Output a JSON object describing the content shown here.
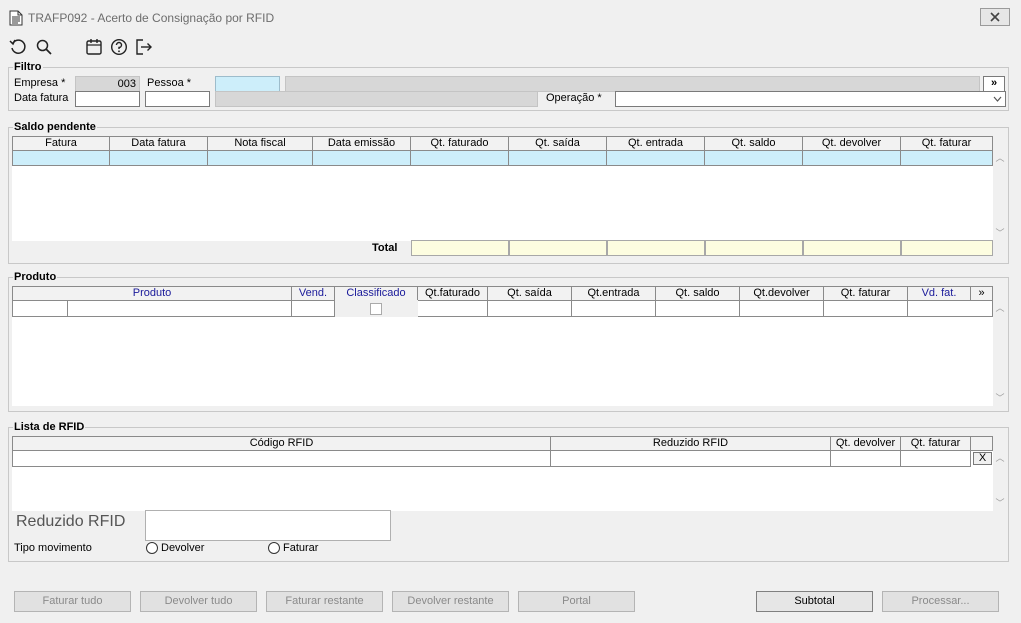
{
  "window": {
    "title": "TRAFP092 - Acerto de Consignação por RFID",
    "close_label": "X"
  },
  "toolbar": {
    "icons": [
      "refresh-icon",
      "search-icon",
      "calendar-icon",
      "help-icon",
      "exit-icon"
    ]
  },
  "filtro": {
    "title": "Filtro",
    "empresa_label": "Empresa *",
    "empresa_value": "003",
    "pessoa_label": "Pessoa *",
    "pessoa_value": "",
    "more_label": "»",
    "data_fatura_label": "Data fatura",
    "operacao_label": "Operação *",
    "operacao_value": ""
  },
  "saldo": {
    "title": "Saldo pendente",
    "columns": [
      "Fatura",
      "Data fatura",
      "Nota fiscal",
      "Data emissão",
      "Qt. faturado",
      "Qt. saída",
      "Qt. entrada",
      "Qt. saldo",
      "Qt. devolver",
      "Qt. faturar"
    ],
    "total_label": "Total"
  },
  "produto": {
    "title": "Produto",
    "columns": [
      "Produto",
      "Vend.",
      "Classificado",
      "Qt.faturado",
      "Qt. saída",
      "Qt.entrada",
      "Qt. saldo",
      "Qt.devolver",
      "Qt. faturar",
      "Vd. fat.",
      "»"
    ]
  },
  "rfid": {
    "title": "Lista de RFID",
    "columns": [
      "Código RFID",
      "Reduzido RFID",
      "Qt. devolver",
      "Qt. faturar",
      ""
    ],
    "remove_label": "X",
    "reduzido_label": "Reduzido RFID",
    "reduzido_value": "",
    "tipo_label": "Tipo movimento",
    "devolver_label": "Devolver",
    "faturar_label": "Faturar"
  },
  "buttons": {
    "faturar_tudo": "Faturar tudo",
    "devolver_tudo": "Devolver tudo",
    "faturar_restante": "Faturar restante",
    "devolver_restante": "Devolver restante",
    "portal": "Portal",
    "subtotal": "Subtotal",
    "processar": "Processar..."
  }
}
